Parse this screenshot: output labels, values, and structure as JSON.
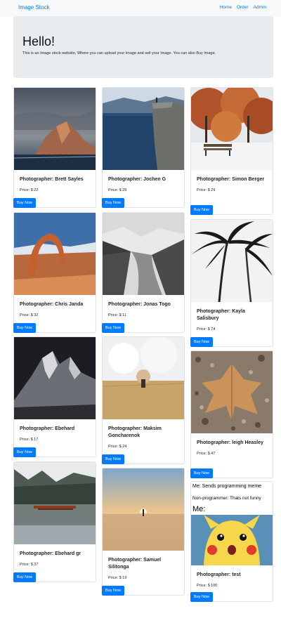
{
  "navbar": {
    "brand": "Image Stock",
    "links": [
      "Home",
      "Order",
      "Admin"
    ]
  },
  "jumbotron": {
    "title": "Hello!",
    "lead": "This is an Image stock website, Where you can upload your Image and sell your Image. You can also Buy Image."
  },
  "buy_label": "Buy Now",
  "cards": [
    {
      "photographer": "Photographer: Brett Sayles",
      "price": "Price: $ 22",
      "image": "canyon-sunset-photo"
    },
    {
      "photographer": "Photographer: Jochen G",
      "price": "Price: $ 28",
      "image": "cliff-fjord-photo"
    },
    {
      "photographer": "Photographer: Simon Berger",
      "price": "Price: $ 29",
      "image": "winter-bench-photo"
    },
    {
      "photographer": "Photographer: Chris Janda",
      "price": "Price: $ 32",
      "image": "delicate-arch-photo"
    },
    {
      "photographer": "Photographer: Jonas Togo",
      "price": "Price: $ 11",
      "image": "fjord-valley-photo"
    },
    {
      "photographer": "Photographer: Kayla Salisbury",
      "price": "Price: $ 74",
      "image": "palm-trees-photo"
    },
    {
      "photographer": "Photographer: Ebehard",
      "price": "Price: $ 17",
      "image": "snowy-peaks-photo"
    },
    {
      "photographer": "Photographer: Maksim Goncharenok",
      "price": "Price: $ 24",
      "image": "wheat-field-photo"
    },
    {
      "photographer": "Photographer: leigh Heasley",
      "price": "Price: $ 47",
      "image": "dry-leaf-photo"
    },
    {
      "photographer": "Photographer: Ebehard gr",
      "price": "Price: $ 37",
      "image": "lake-boat-photo"
    },
    {
      "photographer": "Photographer: Samuel Silitonga",
      "price": "Price: $ 19",
      "image": "beach-sunset-photo"
    },
    {
      "photographer": "Photographer: test",
      "price": "Price: $ 100",
      "image": "surprised-pikachu-meme"
    }
  ],
  "meme": {
    "line1": "Me: Sends programming meme",
    "line2": "Non-programmer: Thats not funny",
    "line3": "Me:"
  }
}
